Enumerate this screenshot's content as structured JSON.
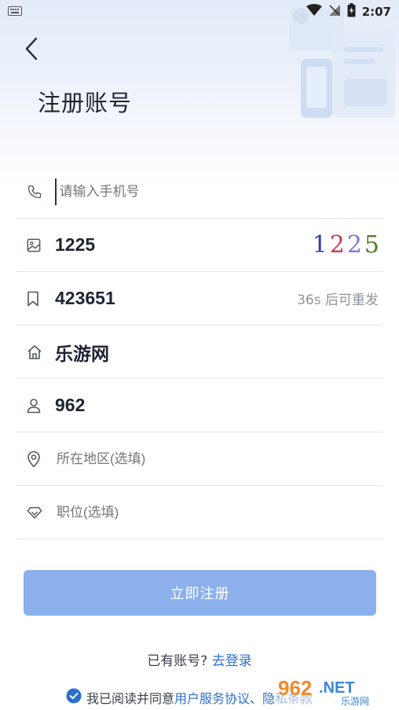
{
  "status_bar": {
    "time": "2:07"
  },
  "header": {
    "title": "注册账号"
  },
  "form": {
    "phone": {
      "placeholder": "请输入手机号",
      "value": ""
    },
    "captcha": {
      "value": "1225",
      "image_chars": [
        "1",
        "2",
        "2",
        "5"
      ]
    },
    "sms_code": {
      "value": "423651",
      "resend_label": "36s 后可重发"
    },
    "company": {
      "value": "乐游网"
    },
    "name": {
      "value": "962"
    },
    "region": {
      "placeholder": "所在地区(选填)"
    },
    "position": {
      "placeholder": "职位(选填)"
    }
  },
  "submit": {
    "label": "立即注册"
  },
  "login": {
    "prompt": "已有账号?",
    "link": "去登录"
  },
  "agreement": {
    "text": "我已阅读并同意",
    "link1": "用户服务协议",
    "sep": "、",
    "link2": "隐私条款"
  },
  "watermark": {
    "brand": "962",
    "suffix": ".NET",
    "sub": "乐游网"
  },
  "colors": {
    "accent": "#2b6fd1",
    "button": "#8bb0ec",
    "divider": "#e4e6ea",
    "placeholder": "#b5b9c0"
  }
}
